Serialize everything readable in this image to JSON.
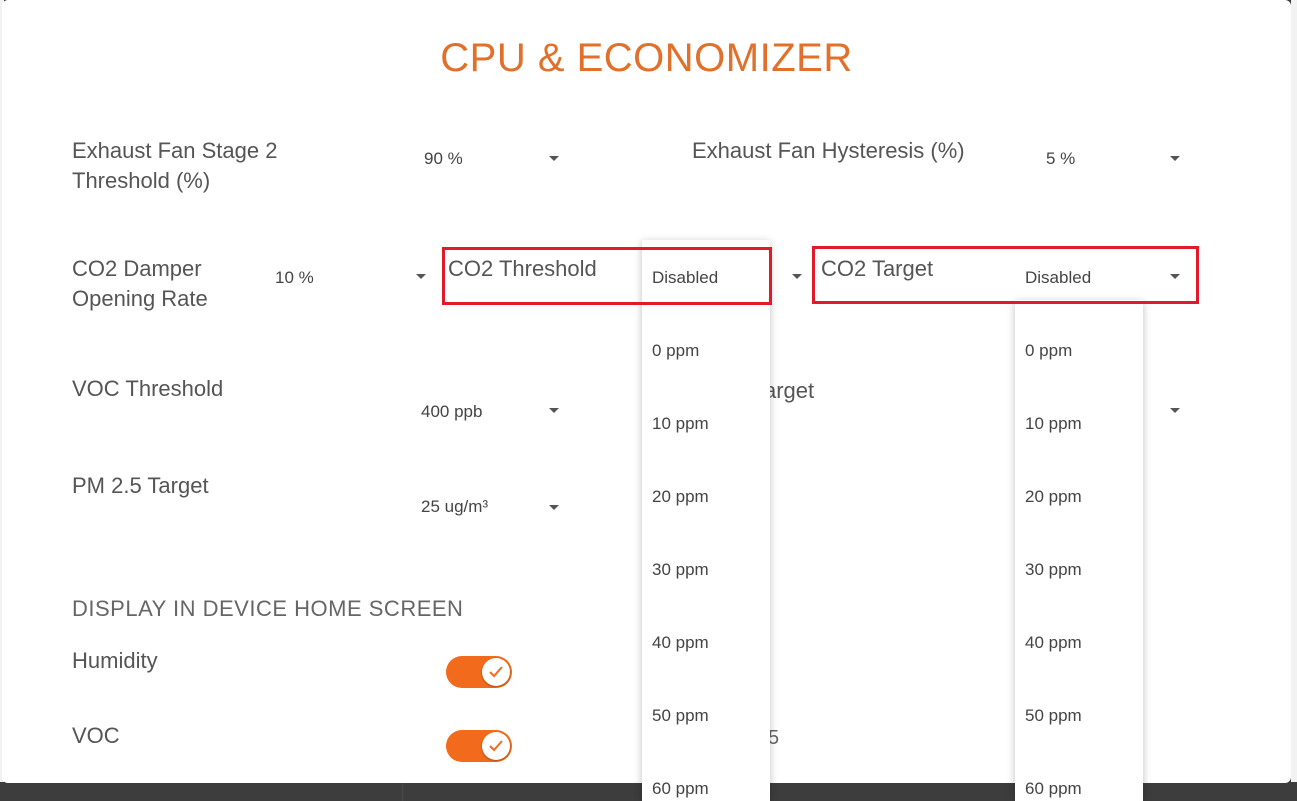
{
  "dialog": {
    "title": "CPU & ECONOMIZER"
  },
  "fields": {
    "exhaust_fan_stage2": {
      "label_line1": "Exhaust Fan Stage 2",
      "label_line2": "Threshold (%)",
      "value": "90 %"
    },
    "exhaust_fan_hysteresis": {
      "label": "Exhaust Fan Hysteresis (%)",
      "value": "5 %"
    },
    "co2_damper": {
      "label_line1": "CO2 Damper",
      "label_line2": "Opening Rate",
      "value": "10 %"
    },
    "co2_threshold": {
      "label": "CO2 Threshold",
      "value": "Disabled"
    },
    "co2_target": {
      "label": "CO2 Target",
      "value": "Disabled"
    },
    "voc_threshold": {
      "label": "VOC Threshold",
      "value": "400 ppb"
    },
    "voc_target_partial": {
      "label": "arget"
    },
    "pm25_target": {
      "label": "PM 2.5 Target",
      "value": "25 ug/m³"
    }
  },
  "display_section": {
    "header": "DISPLAY IN DEVICE HOME SCREEN",
    "humidity": {
      "label": "Humidity",
      "enabled": true
    },
    "voc": {
      "label": "VOC",
      "enabled": true
    }
  },
  "co2_threshold_options": [
    "0 ppm",
    "10 ppm",
    "20 ppm",
    "30 ppm",
    "40 ppm",
    "50 ppm",
    "60 ppm"
  ],
  "co2_target_options": [
    "0 ppm",
    "10 ppm",
    "20 ppm",
    "30 ppm",
    "40 ppm",
    "50 ppm",
    "60 ppm"
  ],
  "partial_text": "5",
  "colors": {
    "accent": "#e0702a",
    "toggle_on": "#f26b1d",
    "highlight": "#e11a2a"
  }
}
